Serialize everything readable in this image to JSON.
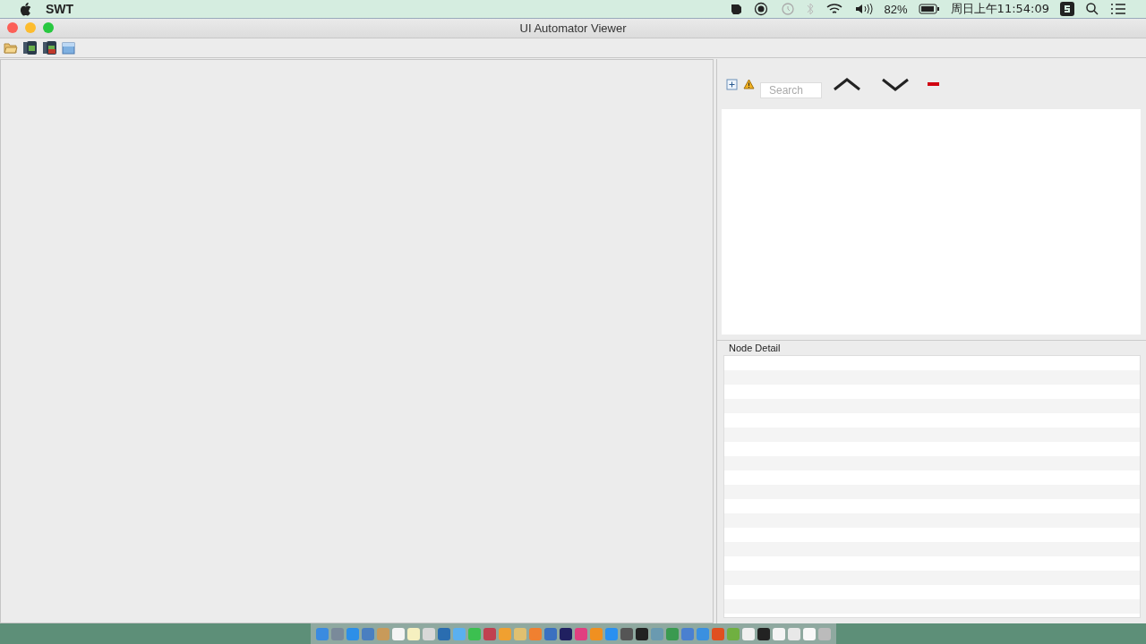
{
  "menu_bar": {
    "app_name": "SWT",
    "battery": "82%",
    "clock": "周日上午11:54:09"
  },
  "window": {
    "title": "UI Automator Viewer"
  },
  "hierarchy_panel": {
    "search": {
      "placeholder": "Search"
    }
  },
  "node_detail": {
    "title": "Node Detail"
  }
}
